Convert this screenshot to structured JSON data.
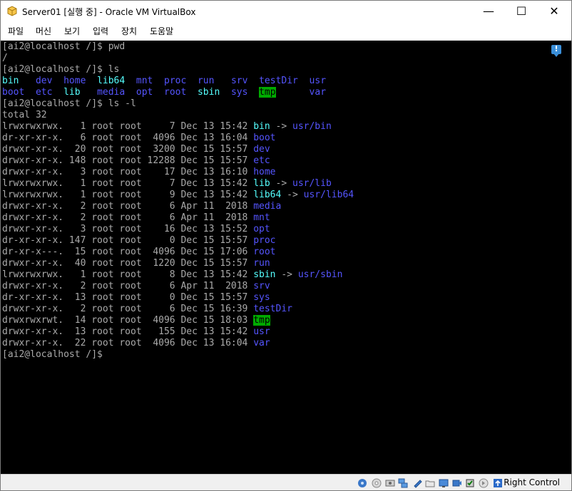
{
  "window": {
    "title": "Server01 [실행 중] - Oracle VM VirtualBox",
    "minimize": "—",
    "maximize": "☐",
    "close": "✕"
  },
  "menu": [
    "파일",
    "머신",
    "보기",
    "입력",
    "장치",
    "도움말"
  ],
  "terminal": {
    "lines": [
      [
        [
          "[ai2@localhost /]$ pwd",
          "plain"
        ]
      ],
      [
        [
          "/",
          "plain"
        ]
      ],
      [
        [
          "[ai2@localhost /]$ ls",
          "plain"
        ]
      ],
      [
        [
          "bin",
          "link"
        ],
        [
          "   ",
          "plain"
        ],
        [
          "dev",
          "dir"
        ],
        [
          "  ",
          "plain"
        ],
        [
          "home",
          "dir"
        ],
        [
          "  ",
          "plain"
        ],
        [
          "lib64",
          "link"
        ],
        [
          "  ",
          "plain"
        ],
        [
          "mnt",
          "dir"
        ],
        [
          "  ",
          "plain"
        ],
        [
          "proc",
          "dir"
        ],
        [
          "  ",
          "plain"
        ],
        [
          "run",
          "dir"
        ],
        [
          "   ",
          "plain"
        ],
        [
          "srv",
          "dir"
        ],
        [
          "  ",
          "plain"
        ],
        [
          "testDir",
          "dir"
        ],
        [
          "  ",
          "plain"
        ],
        [
          "usr",
          "dir"
        ]
      ],
      [
        [
          "boot",
          "dir"
        ],
        [
          "  ",
          "plain"
        ],
        [
          "etc",
          "dir"
        ],
        [
          "  ",
          "plain"
        ],
        [
          "lib",
          "link"
        ],
        [
          "   ",
          "plain"
        ],
        [
          "media",
          "dir"
        ],
        [
          "  ",
          "plain"
        ],
        [
          "opt",
          "dir"
        ],
        [
          "  ",
          "plain"
        ],
        [
          "root",
          "dir"
        ],
        [
          "  ",
          "plain"
        ],
        [
          "sbin",
          "link"
        ],
        [
          "  ",
          "plain"
        ],
        [
          "sys",
          "dir"
        ],
        [
          "  ",
          "plain"
        ],
        [
          "tmp",
          "tmp"
        ],
        [
          "      ",
          "plain"
        ],
        [
          "var",
          "dir"
        ]
      ],
      [
        [
          "[ai2@localhost /]$ ls -l",
          "plain"
        ]
      ],
      [
        [
          "total 32",
          "plain"
        ]
      ],
      [
        [
          "lrwxrwxrwx.   1 root root     7 Dec 13 15:42 ",
          "plain"
        ],
        [
          "bin",
          "link"
        ],
        [
          " -> ",
          "plain"
        ],
        [
          "usr/bin",
          "dir"
        ]
      ],
      [
        [
          "dr-xr-xr-x.   6 root root  4096 Dec 13 16:04 ",
          "plain"
        ],
        [
          "boot",
          "dir"
        ]
      ],
      [
        [
          "drwxr-xr-x.  20 root root  3200 Dec 15 15:57 ",
          "plain"
        ],
        [
          "dev",
          "dir"
        ]
      ],
      [
        [
          "drwxr-xr-x. 148 root root 12288 Dec 15 15:57 ",
          "plain"
        ],
        [
          "etc",
          "dir"
        ]
      ],
      [
        [
          "drwxr-xr-x.   3 root root    17 Dec 13 16:10 ",
          "plain"
        ],
        [
          "home",
          "dir"
        ]
      ],
      [
        [
          "lrwxrwxrwx.   1 root root     7 Dec 13 15:42 ",
          "plain"
        ],
        [
          "lib",
          "link"
        ],
        [
          " -> ",
          "plain"
        ],
        [
          "usr/lib",
          "dir"
        ]
      ],
      [
        [
          "lrwxrwxrwx.   1 root root     9 Dec 13 15:42 ",
          "plain"
        ],
        [
          "lib64",
          "link"
        ],
        [
          " -> ",
          "plain"
        ],
        [
          "usr/lib64",
          "dir"
        ]
      ],
      [
        [
          "drwxr-xr-x.   2 root root     6 Apr 11  2018 ",
          "plain"
        ],
        [
          "media",
          "dir"
        ]
      ],
      [
        [
          "drwxr-xr-x.   2 root root     6 Apr 11  2018 ",
          "plain"
        ],
        [
          "mnt",
          "dir"
        ]
      ],
      [
        [
          "drwxr-xr-x.   3 root root    16 Dec 13 15:52 ",
          "plain"
        ],
        [
          "opt",
          "dir"
        ]
      ],
      [
        [
          "dr-xr-xr-x. 147 root root     0 Dec 15 15:57 ",
          "plain"
        ],
        [
          "proc",
          "dir"
        ]
      ],
      [
        [
          "dr-xr-x---.  15 root root  4096 Dec 15 17:06 ",
          "plain"
        ],
        [
          "root",
          "dir"
        ]
      ],
      [
        [
          "drwxr-xr-x.  40 root root  1220 Dec 15 15:57 ",
          "plain"
        ],
        [
          "run",
          "dir"
        ]
      ],
      [
        [
          "lrwxrwxrwx.   1 root root     8 Dec 13 15:42 ",
          "plain"
        ],
        [
          "sbin",
          "link"
        ],
        [
          " -> ",
          "plain"
        ],
        [
          "usr/sbin",
          "dir"
        ]
      ],
      [
        [
          "drwxr-xr-x.   2 root root     6 Apr 11  2018 ",
          "plain"
        ],
        [
          "srv",
          "dir"
        ]
      ],
      [
        [
          "dr-xr-xr-x.  13 root root     0 Dec 15 15:57 ",
          "plain"
        ],
        [
          "sys",
          "dir"
        ]
      ],
      [
        [
          "drwxr-xr-x.   2 root root     6 Dec 15 16:39 ",
          "plain"
        ],
        [
          "testDir",
          "dir"
        ]
      ],
      [
        [
          "drwxrwxrwt.  14 root root  4096 Dec 15 18:03 ",
          "plain"
        ],
        [
          "tmp",
          "tmp"
        ]
      ],
      [
        [
          "drwxr-xr-x.  13 root root   155 Dec 13 15:42 ",
          "plain"
        ],
        [
          "usr",
          "dir"
        ]
      ],
      [
        [
          "drwxr-xr-x.  22 root root  4096 Dec 13 16:04 ",
          "plain"
        ],
        [
          "var",
          "dir"
        ]
      ],
      [
        [
          "[ai2@localhost /]$ ",
          "plain"
        ]
      ]
    ],
    "colors": {
      "background": "#000000",
      "plain": "#aaaaaa",
      "dir": "#5555ff",
      "link": "#55ffff",
      "tmp_fg": "#000000",
      "tmp_bg": "#00aa00"
    }
  },
  "notification": {
    "icon": "message-icon",
    "glyph": "!"
  },
  "statusbar": {
    "icons": [
      "hard-disk-icon",
      "optical-drive-icon",
      "audio-icon",
      "network-icon",
      "usb-icon",
      "shared-folders-icon",
      "display-icon",
      "video-capture-icon",
      "cpu-icon",
      "mouse-integration-icon",
      "host-key-arrow-icon"
    ],
    "host_key": "Right Control"
  }
}
